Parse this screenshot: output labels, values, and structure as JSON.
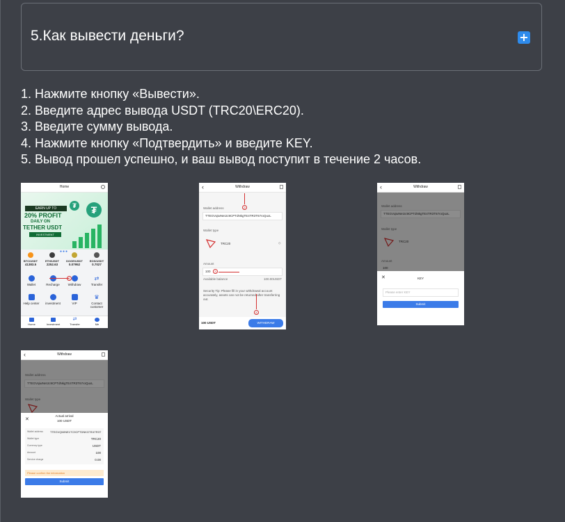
{
  "faq": {
    "question": "5.Как вывести деньги?",
    "expand_icon": "plus-icon",
    "expand_symbol": "+",
    "accent": "#2e8bec",
    "steps": [
      "1. Нажмите кнопку «Вывести».",
      "2. Введите адрес вывода USDT (TRC20\\ERC20).",
      "3. Введите сумму вывода.",
      "4. Нажмите кнопку «Подтвердить» и введите KEY.",
      "5. Вывод прошел успешно, и ваш вывод поступит в течение 2 часов."
    ]
  },
  "shot1": {
    "title": "Home",
    "banner": {
      "earn": "EARN UP TO",
      "profit": "20% PROFIT",
      "daily": "DAILY ON",
      "tether": "TETHER USDT",
      "invest": "INVESTMENT"
    },
    "tickers": [
      {
        "name": "BTC/USDT",
        "value": "41383.5",
        "color": "#f7931a"
      },
      {
        "name": "ETH/USDT",
        "value": "2252.63",
        "color": "#3c3c3d"
      },
      {
        "name": "DOGE/USDT",
        "value": "0.07952",
        "color": "#c2a633"
      },
      {
        "name": "EOS/USDT",
        "value": "0.7027",
        "color": "#555555"
      }
    ],
    "menu": [
      "Wallet",
      "Recharge",
      "Withdraw",
      "Transfer",
      "Help center",
      "investment",
      "VIP",
      "Contact customer"
    ],
    "tabs": [
      "Home",
      "Investment",
      "Transfer",
      "Me"
    ]
  },
  "shot2": {
    "title": "Withdraw",
    "wallet_label": "Wallet address",
    "wallet_value": "TTEGVqiwNe1tc9CPTdNkgTE4TR3T67roQuxL",
    "type_label": "Wallet type",
    "type_value": "TRC20",
    "amount_label": "Amount",
    "amount_value": "100",
    "balance_label": "Available balance",
    "balance_value": "100.00USDT",
    "tip": "Security Tip: Please fill in your withdrawal account accurately, assets can not be returned after transferring out.",
    "fee": "100 USDT",
    "button": "WITHDRAW",
    "marks": [
      "2",
      "3",
      "4"
    ]
  },
  "shot3": {
    "title": "Withdraw",
    "wallet_label": "Wallet address",
    "wallet_value": "TTEGVqiwNe1tc9CPTdNkgTE4TR3T67roQuxL",
    "type_label": "Wallet type",
    "type_value": "TRC20",
    "amount_label": "Amount",
    "amount_value": "100",
    "key_title": "KEY",
    "key_placeholder": "Please enter KEY",
    "submit": "Submit"
  },
  "shot4": {
    "title": "Withdraw",
    "wallet_label": "Wallet address",
    "wallet_value": "TTEGVqiwNe1tc9CPTdNkgTE4TR3T67roQuxL",
    "type_label": "Wallet type",
    "arrival_title": "Actual arrival",
    "arrival_value": "100 USDT",
    "rows": [
      {
        "k": "Wallet address",
        "v": "TTEGVQiWNE1TC9CPTDNKGTE4TR3T"
      },
      {
        "k": "Wallet type",
        "v": "TRC20"
      },
      {
        "k": "Currency type",
        "v": "USDT"
      },
      {
        "k": "Amount",
        "v": "100"
      },
      {
        "k": "Service charge",
        "v": "0.00"
      }
    ],
    "confirm": "Please confirm the information",
    "submit": "Submit"
  }
}
